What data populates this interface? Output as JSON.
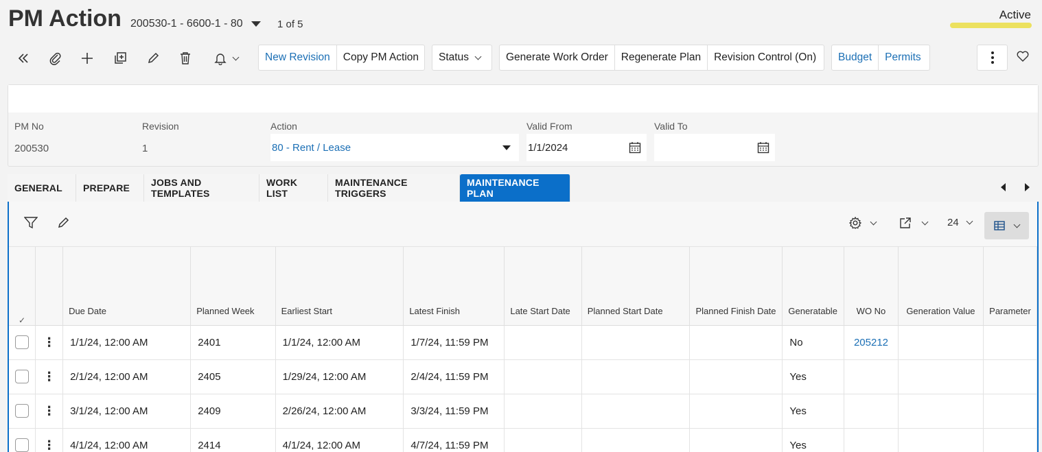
{
  "header": {
    "title": "PM Action",
    "record": "200530-1 - 6600-1 - 80",
    "count": "1 of 5",
    "status": "Active",
    "status_color": "#ece15f"
  },
  "toolbar": {
    "icons": [
      "double-chevron-left-icon",
      "paperclip-icon",
      "plus-icon",
      "duplicate-icon",
      "pencil-icon",
      "trash-icon",
      "bell-icon"
    ],
    "new_revision": "New Revision",
    "copy_pm_action": "Copy PM Action",
    "status": "Status",
    "generate_work_order": "Generate Work Order",
    "regenerate_plan": "Regenerate Plan",
    "revision_control": "Revision Control (On)",
    "budget": "Budget",
    "permits": "Permits",
    "accent_color": "#1b6fb5"
  },
  "form": {
    "pm_no_label": "PM No",
    "pm_no": "200530",
    "revision_label": "Revision",
    "revision": "1",
    "action_label": "Action",
    "action": "80 - Rent / Lease",
    "valid_from_label": "Valid From",
    "valid_from": "1/1/2024",
    "valid_to_label": "Valid To",
    "valid_to": ""
  },
  "tabs": [
    "GENERAL",
    "PREPARE",
    "JOBS AND TEMPLATES",
    "WORK LIST",
    "MAINTENANCE TRIGGERS",
    "MAINTENANCE PLAN"
  ],
  "active_tab": "MAINTENANCE PLAN",
  "tab_color": "#0b6fc9",
  "grid": {
    "page_size": "24",
    "columns": [
      "Due Date",
      "Planned Week",
      "Earliest Start",
      "Latest Finish",
      "Late Start Date",
      "Planned Start Date",
      "Planned Finish Date",
      "Generatable",
      "WO No",
      "Generation Value",
      "Parameter"
    ],
    "rows": [
      {
        "due_date": "1/1/24, 12:00 AM",
        "planned_week": "2401",
        "earliest_start": "1/1/24, 12:00 AM",
        "latest_finish": "1/7/24, 11:59 PM",
        "generatable": "No",
        "wo_no": "205212"
      },
      {
        "due_date": "2/1/24, 12:00 AM",
        "planned_week": "2405",
        "earliest_start": "1/29/24, 12:00 AM",
        "latest_finish": "2/4/24, 11:59 PM",
        "generatable": "Yes",
        "wo_no": ""
      },
      {
        "due_date": "3/1/24, 12:00 AM",
        "planned_week": "2409",
        "earliest_start": "2/26/24, 12:00 AM",
        "latest_finish": "3/3/24, 11:59 PM",
        "generatable": "Yes",
        "wo_no": ""
      },
      {
        "due_date": "4/1/24, 12:00 AM",
        "planned_week": "2414",
        "earliest_start": "4/1/24, 12:00 AM",
        "latest_finish": "4/7/24, 11:59 PM",
        "generatable": "Yes",
        "wo_no": ""
      }
    ]
  }
}
